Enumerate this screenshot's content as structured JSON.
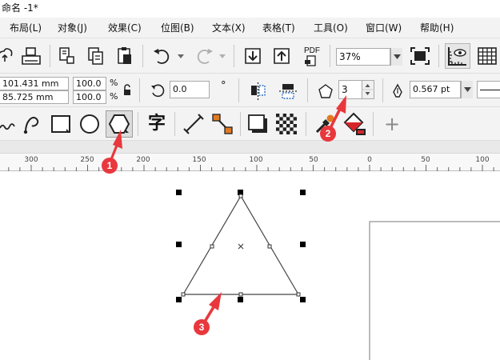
{
  "title_bar": {
    "text": "命名 -1*"
  },
  "menu": {
    "items": [
      {
        "key": "layout",
        "label": "布局(L)"
      },
      {
        "key": "object",
        "label": "对象(J)"
      },
      {
        "key": "effects",
        "label": "效果(C)"
      },
      {
        "key": "bitmaps",
        "label": "位图(B)"
      },
      {
        "key": "text",
        "label": "文本(X)"
      },
      {
        "key": "table",
        "label": "表格(T)"
      },
      {
        "key": "tools",
        "label": "工具(O)"
      },
      {
        "key": "window",
        "label": "窗口(W)"
      },
      {
        "key": "help",
        "label": "帮助(H)"
      }
    ]
  },
  "standard_toolbar": {
    "export_pdf_label": "PDF",
    "zoom_level": "37%"
  },
  "property_bar": {
    "object_width": "101.431 mm",
    "object_height": "85.725 mm",
    "scale_x": "100.0",
    "scale_y": "100.0",
    "percent_symbol": "%",
    "rotation_angle": "0.0",
    "degree_symbol": "°",
    "polygon_sides": "3",
    "outline_width": "0.567 pt"
  },
  "toolbox": {
    "text_tool_glyph": "字",
    "add_tool_glyph": "+"
  },
  "ruler": {
    "labels": [
      "300",
      "250",
      "200",
      "150",
      "100",
      "50",
      "0",
      "50",
      "100"
    ]
  },
  "annotations": {
    "marker_1": "1",
    "marker_2": "2",
    "marker_3": "3",
    "marker_color": "#e8383d"
  },
  "colors": {
    "accent_blue": "#2f6fc4",
    "accent_orange": "#e07b22",
    "accent_red": "#d7262b",
    "selection_handle": "#000000"
  }
}
